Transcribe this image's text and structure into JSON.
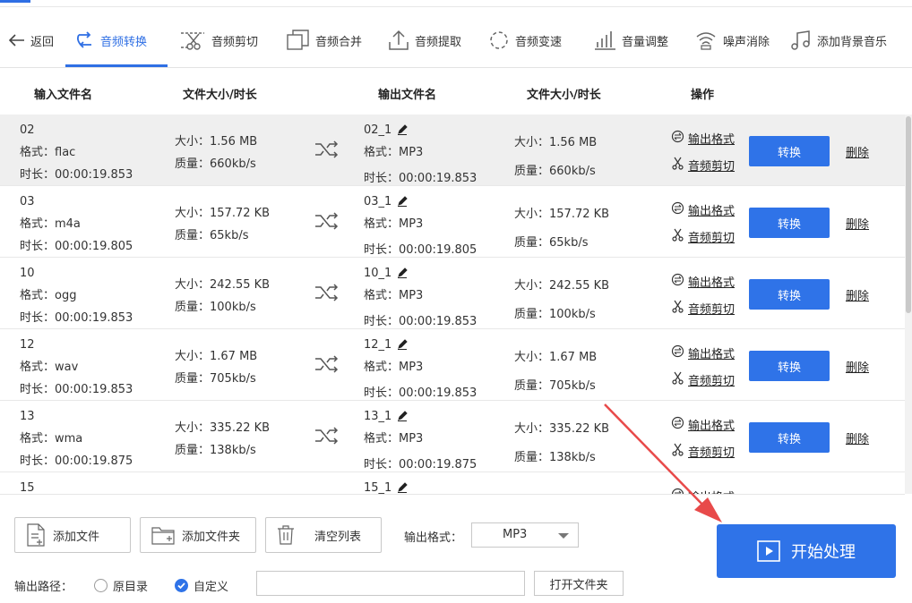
{
  "toolbar": {
    "back": "返回",
    "items": [
      {
        "label": "音频转换",
        "icon": "convert-icon"
      },
      {
        "label": "音频剪切",
        "icon": "cut-icon"
      },
      {
        "label": "音频合并",
        "icon": "merge-icon"
      },
      {
        "label": "音频提取",
        "icon": "extract-icon"
      },
      {
        "label": "音频变速",
        "icon": "speed-icon"
      },
      {
        "label": "音量调整",
        "icon": "volume-icon"
      },
      {
        "label": "噪声消除",
        "icon": "noise-icon"
      },
      {
        "label": "添加背景音乐",
        "icon": "music-icon"
      }
    ]
  },
  "table": {
    "headers": {
      "input_name": "输入文件名",
      "size_duration_in": "文件大小/时长",
      "output_name": "输出文件名",
      "size_duration_out": "文件大小/时长",
      "actions": "操作"
    },
    "rows": [
      {
        "name": "02",
        "format": "格式：flac",
        "duration": "时长：00:00:19.853",
        "size": "大小：1.56 MB",
        "quality": "质量：660kb/s",
        "out_name": "02_1",
        "out_format": "格式：MP3",
        "out_duration": "时长：00:00:19.853",
        "out_size": "大小：1.56 MB",
        "out_quality": "质量：660kb/s"
      },
      {
        "name": "03",
        "format": "格式：m4a",
        "duration": "时长：00:00:19.805",
        "size": "大小：157.72 KB",
        "quality": "质量：65kb/s",
        "out_name": "03_1",
        "out_format": "格式：MP3",
        "out_duration": "时长：00:00:19.805",
        "out_size": "大小：157.72 KB",
        "out_quality": "质量：65kb/s"
      },
      {
        "name": "10",
        "format": "格式：ogg",
        "duration": "时长：00:00:19.853",
        "size": "大小：242.55 KB",
        "quality": "质量：100kb/s",
        "out_name": "10_1",
        "out_format": "格式：MP3",
        "out_duration": "时长：00:00:19.853",
        "out_size": "大小：242.55 KB",
        "out_quality": "质量：100kb/s"
      },
      {
        "name": "12",
        "format": "格式：wav",
        "duration": "时长：00:00:19.853",
        "size": "大小：1.67 MB",
        "quality": "质量：705kb/s",
        "out_name": "12_1",
        "out_format": "格式：MP3",
        "out_duration": "时长：00:00:19.853",
        "out_size": "大小：1.67 MB",
        "out_quality": "质量：705kb/s"
      },
      {
        "name": "13",
        "format": "格式：wma",
        "duration": "时长：00:00:19.875",
        "size": "大小：335.22 KB",
        "quality": "质量：138kb/s",
        "out_name": "13_1",
        "out_format": "格式：MP3",
        "out_duration": "时长：00:00:19.875",
        "out_size": "大小：335.22 KB",
        "out_quality": "质量：138kb/s"
      },
      {
        "name": "15",
        "out_name": "15_1"
      }
    ],
    "row_actions": {
      "output_format": "输出格式",
      "audio_cut": "音频剪切",
      "convert": "转换",
      "delete": "删除"
    }
  },
  "bottom": {
    "add_file": "添加文件",
    "add_folder": "添加文件夹",
    "clear_list": "清空列表",
    "output_format_label": "输出格式：",
    "output_format_value": "MP3",
    "start": "开始处理",
    "output_path_label": "输出路径：",
    "radio_original": "原目录",
    "radio_custom": "自定义",
    "path_value": "",
    "open_folder": "打开文件夹"
  },
  "colors": {
    "accent": "#2f73e8",
    "annotation_arrow": "#e84a4a"
  }
}
